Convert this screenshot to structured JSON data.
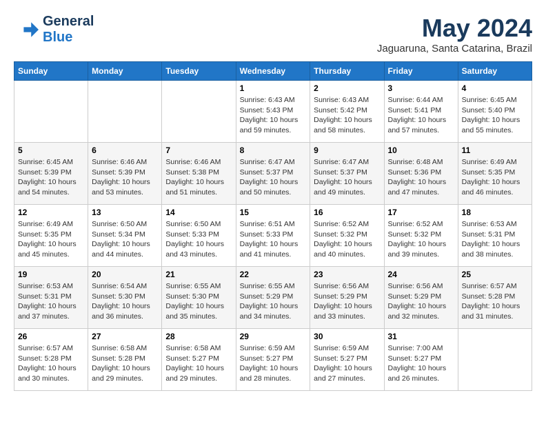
{
  "logo": {
    "line1": "General",
    "line2": "Blue"
  },
  "title": "May 2024",
  "subtitle": "Jaguaruna, Santa Catarina, Brazil",
  "days_header": [
    "Sunday",
    "Monday",
    "Tuesday",
    "Wednesday",
    "Thursday",
    "Friday",
    "Saturday"
  ],
  "weeks": [
    [
      {
        "num": "",
        "info": ""
      },
      {
        "num": "",
        "info": ""
      },
      {
        "num": "",
        "info": ""
      },
      {
        "num": "1",
        "info": "Sunrise: 6:43 AM\nSunset: 5:43 PM\nDaylight: 10 hours\nand 59 minutes."
      },
      {
        "num": "2",
        "info": "Sunrise: 6:43 AM\nSunset: 5:42 PM\nDaylight: 10 hours\nand 58 minutes."
      },
      {
        "num": "3",
        "info": "Sunrise: 6:44 AM\nSunset: 5:41 PM\nDaylight: 10 hours\nand 57 minutes."
      },
      {
        "num": "4",
        "info": "Sunrise: 6:45 AM\nSunset: 5:40 PM\nDaylight: 10 hours\nand 55 minutes."
      }
    ],
    [
      {
        "num": "5",
        "info": "Sunrise: 6:45 AM\nSunset: 5:39 PM\nDaylight: 10 hours\nand 54 minutes."
      },
      {
        "num": "6",
        "info": "Sunrise: 6:46 AM\nSunset: 5:39 PM\nDaylight: 10 hours\nand 53 minutes."
      },
      {
        "num": "7",
        "info": "Sunrise: 6:46 AM\nSunset: 5:38 PM\nDaylight: 10 hours\nand 51 minutes."
      },
      {
        "num": "8",
        "info": "Sunrise: 6:47 AM\nSunset: 5:37 PM\nDaylight: 10 hours\nand 50 minutes."
      },
      {
        "num": "9",
        "info": "Sunrise: 6:47 AM\nSunset: 5:37 PM\nDaylight: 10 hours\nand 49 minutes."
      },
      {
        "num": "10",
        "info": "Sunrise: 6:48 AM\nSunset: 5:36 PM\nDaylight: 10 hours\nand 47 minutes."
      },
      {
        "num": "11",
        "info": "Sunrise: 6:49 AM\nSunset: 5:35 PM\nDaylight: 10 hours\nand 46 minutes."
      }
    ],
    [
      {
        "num": "12",
        "info": "Sunrise: 6:49 AM\nSunset: 5:35 PM\nDaylight: 10 hours\nand 45 minutes."
      },
      {
        "num": "13",
        "info": "Sunrise: 6:50 AM\nSunset: 5:34 PM\nDaylight: 10 hours\nand 44 minutes."
      },
      {
        "num": "14",
        "info": "Sunrise: 6:50 AM\nSunset: 5:33 PM\nDaylight: 10 hours\nand 43 minutes."
      },
      {
        "num": "15",
        "info": "Sunrise: 6:51 AM\nSunset: 5:33 PM\nDaylight: 10 hours\nand 41 minutes."
      },
      {
        "num": "16",
        "info": "Sunrise: 6:52 AM\nSunset: 5:32 PM\nDaylight: 10 hours\nand 40 minutes."
      },
      {
        "num": "17",
        "info": "Sunrise: 6:52 AM\nSunset: 5:32 PM\nDaylight: 10 hours\nand 39 minutes."
      },
      {
        "num": "18",
        "info": "Sunrise: 6:53 AM\nSunset: 5:31 PM\nDaylight: 10 hours\nand 38 minutes."
      }
    ],
    [
      {
        "num": "19",
        "info": "Sunrise: 6:53 AM\nSunset: 5:31 PM\nDaylight: 10 hours\nand 37 minutes."
      },
      {
        "num": "20",
        "info": "Sunrise: 6:54 AM\nSunset: 5:30 PM\nDaylight: 10 hours\nand 36 minutes."
      },
      {
        "num": "21",
        "info": "Sunrise: 6:55 AM\nSunset: 5:30 PM\nDaylight: 10 hours\nand 35 minutes."
      },
      {
        "num": "22",
        "info": "Sunrise: 6:55 AM\nSunset: 5:29 PM\nDaylight: 10 hours\nand 34 minutes."
      },
      {
        "num": "23",
        "info": "Sunrise: 6:56 AM\nSunset: 5:29 PM\nDaylight: 10 hours\nand 33 minutes."
      },
      {
        "num": "24",
        "info": "Sunrise: 6:56 AM\nSunset: 5:29 PM\nDaylight: 10 hours\nand 32 minutes."
      },
      {
        "num": "25",
        "info": "Sunrise: 6:57 AM\nSunset: 5:28 PM\nDaylight: 10 hours\nand 31 minutes."
      }
    ],
    [
      {
        "num": "26",
        "info": "Sunrise: 6:57 AM\nSunset: 5:28 PM\nDaylight: 10 hours\nand 30 minutes."
      },
      {
        "num": "27",
        "info": "Sunrise: 6:58 AM\nSunset: 5:28 PM\nDaylight: 10 hours\nand 29 minutes."
      },
      {
        "num": "28",
        "info": "Sunrise: 6:58 AM\nSunset: 5:27 PM\nDaylight: 10 hours\nand 29 minutes."
      },
      {
        "num": "29",
        "info": "Sunrise: 6:59 AM\nSunset: 5:27 PM\nDaylight: 10 hours\nand 28 minutes."
      },
      {
        "num": "30",
        "info": "Sunrise: 6:59 AM\nSunset: 5:27 PM\nDaylight: 10 hours\nand 27 minutes."
      },
      {
        "num": "31",
        "info": "Sunrise: 7:00 AM\nSunset: 5:27 PM\nDaylight: 10 hours\nand 26 minutes."
      },
      {
        "num": "",
        "info": ""
      }
    ]
  ]
}
